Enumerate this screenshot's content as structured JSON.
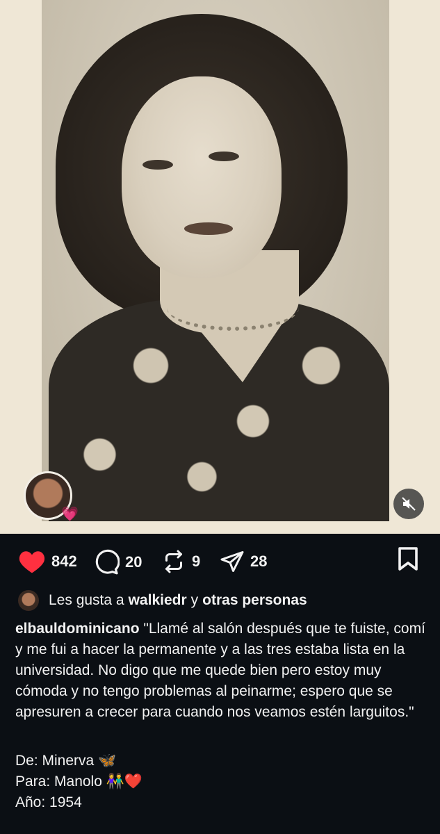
{
  "post": {
    "media": {
      "description_icon": "mute-icon"
    },
    "actions": {
      "likes_count": "842",
      "comments_count": "20",
      "reposts_count": "9",
      "shares_count": "28"
    },
    "liked_by": {
      "prefix": "Les gusta a",
      "user": "walkiedr",
      "conjunction": "y",
      "others": "otras personas"
    },
    "caption": {
      "username": "elbauldominicano",
      "text": "\"Llamé al salón después que te fuiste, comí y me fui a hacer la permanente y a las tres estaba lista en la universidad. No digo que me quede bien pero estoy muy cómoda y no tengo problemas al peinarme; espero que se apresuren a crecer para cuando nos veamos estén larguitos.\"",
      "line_de": "De: Minerva 🦋",
      "line_para": "Para: Manolo 👫❤️",
      "line_anio": "Año: 1954"
    }
  },
  "colors": {
    "background": "#0b0f14",
    "like_red": "#ff3040",
    "text": "#f2f2f2"
  }
}
